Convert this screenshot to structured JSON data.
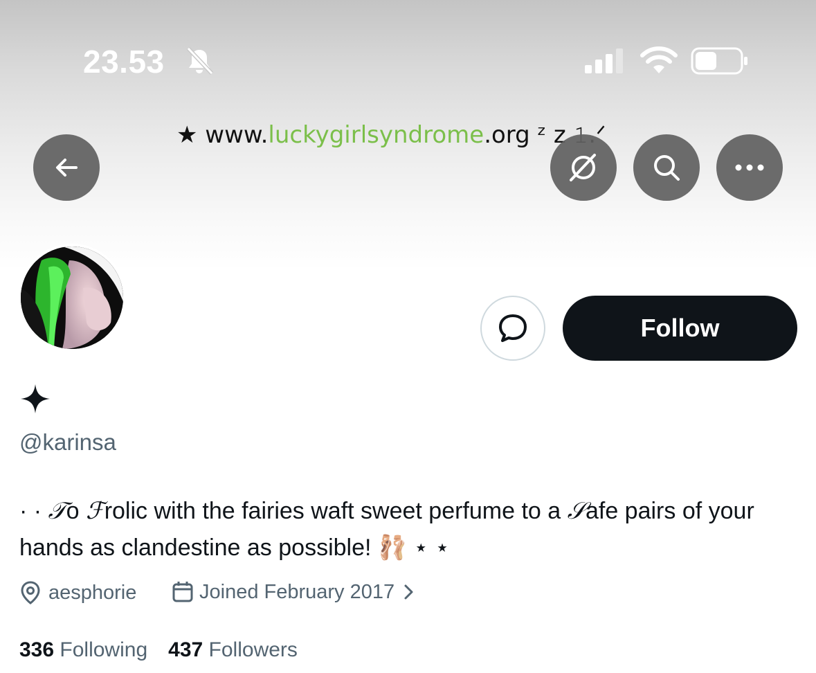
{
  "status_bar": {
    "time": "23.53"
  },
  "banner": {
    "prefix": "★ www.",
    "highlight": "luckygirlsyndrome",
    "suffix": ".org ᶻ z 𝟷.ᐟ",
    "highlight_color": "#7bbf4a"
  },
  "header_buttons": {
    "back": "arrow-left-icon",
    "grok": "grok-icon",
    "search": "search-icon",
    "more": "more-icon"
  },
  "profile": {
    "display_name_icon": "four-point-star-icon",
    "handle": "@karinsa",
    "bio_lead": "· · ",
    "bio_fancy_1": "𝒯",
    "bio_part_1": "o ",
    "bio_fancy_2": "ℱ",
    "bio_part_2": "rolic with the fairies waft sweet perfume to a ",
    "bio_fancy_3": "𝒮",
    "bio_part_3": "afe pairs of your hands as clandestine as possible! 🩰 ⋆ ⋆",
    "location": "aesphorie",
    "joined": "Joined February 2017",
    "following_count": "336",
    "following_label": "Following",
    "followers_count": "437",
    "followers_label": "Followers"
  },
  "actions": {
    "follow_label": "Follow"
  },
  "colors": {
    "primary_text": "#0f1419",
    "secondary_text": "#536471",
    "follow_bg": "#0f1419"
  }
}
